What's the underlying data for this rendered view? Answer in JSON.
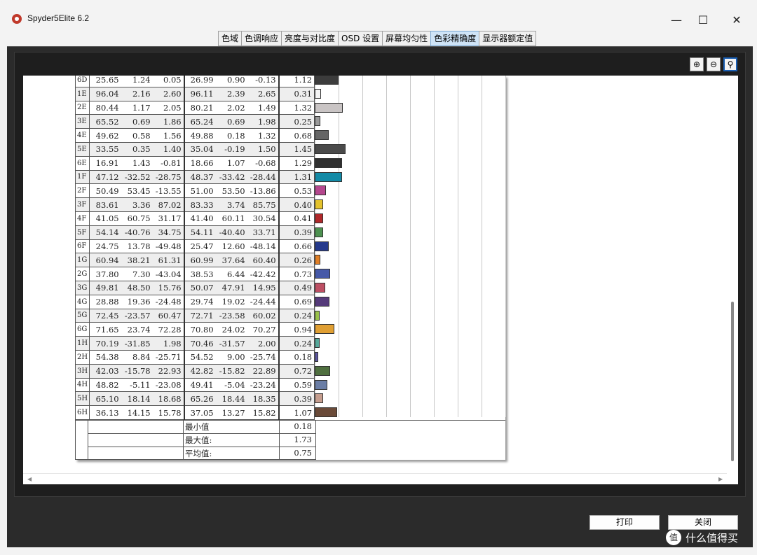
{
  "window": {
    "title": "Spyder5Elite 6.2"
  },
  "tabs": [
    "色域",
    "色调响应",
    "亮度与对比度",
    "OSD 设置",
    "屏幕均匀性",
    "色彩精确度",
    "显示器额定值"
  ],
  "active_tab_index": 5,
  "zoom": {
    "zoom_in": "zoom-in",
    "zoom_out": "zoom-out",
    "zoom_fit": "zoom-fit"
  },
  "rows": [
    [
      "6D",
      "25.65",
      "1.24",
      "0.05",
      "26.99",
      "0.90",
      "-0.13",
      "1.12"
    ],
    [
      "1E",
      "96.04",
      "2.16",
      "2.60",
      "96.11",
      "2.39",
      "2.65",
      "0.31"
    ],
    [
      "2E",
      "80.44",
      "1.17",
      "2.05",
      "80.21",
      "2.02",
      "1.49",
      "1.32"
    ],
    [
      "3E",
      "65.52",
      "0.69",
      "1.86",
      "65.24",
      "0.69",
      "1.98",
      "0.25"
    ],
    [
      "4E",
      "49.62",
      "0.58",
      "1.56",
      "49.88",
      "0.18",
      "1.32",
      "0.68"
    ],
    [
      "5E",
      "33.55",
      "0.35",
      "1.40",
      "35.04",
      "-0.19",
      "1.50",
      "1.45"
    ],
    [
      "6E",
      "16.91",
      "1.43",
      "-0.81",
      "18.66",
      "1.07",
      "-0.68",
      "1.29"
    ],
    [
      "1F",
      "47.12",
      "-32.52",
      "-28.75",
      "48.37",
      "-33.42",
      "-28.44",
      "1.31"
    ],
    [
      "2F",
      "50.49",
      "53.45",
      "-13.55",
      "51.00",
      "53.50",
      "-13.86",
      "0.53"
    ],
    [
      "3F",
      "83.61",
      "3.36",
      "87.02",
      "83.33",
      "3.74",
      "85.75",
      "0.40"
    ],
    [
      "4F",
      "41.05",
      "60.75",
      "31.17",
      "41.40",
      "60.11",
      "30.54",
      "0.41"
    ],
    [
      "5F",
      "54.14",
      "-40.76",
      "34.75",
      "54.11",
      "-40.40",
      "33.71",
      "0.39"
    ],
    [
      "6F",
      "24.75",
      "13.78",
      "-49.48",
      "25.47",
      "12.60",
      "-48.14",
      "0.66"
    ],
    [
      "1G",
      "60.94",
      "38.21",
      "61.31",
      "60.99",
      "37.64",
      "60.40",
      "0.26"
    ],
    [
      "2G",
      "37.80",
      "7.30",
      "-43.04",
      "38.53",
      "6.44",
      "-42.42",
      "0.73"
    ],
    [
      "3G",
      "49.81",
      "48.50",
      "15.76",
      "50.07",
      "47.91",
      "14.95",
      "0.49"
    ],
    [
      "4G",
      "28.88",
      "19.36",
      "-24.48",
      "29.74",
      "19.02",
      "-24.44",
      "0.69"
    ],
    [
      "5G",
      "72.45",
      "-23.57",
      "60.47",
      "72.71",
      "-23.58",
      "60.02",
      "0.24"
    ],
    [
      "6G",
      "71.65",
      "23.74",
      "72.28",
      "70.80",
      "24.02",
      "70.27",
      "0.94"
    ],
    [
      "1H",
      "70.19",
      "-31.85",
      "1.98",
      "70.46",
      "-31.57",
      "2.00",
      "0.24"
    ],
    [
      "2H",
      "54.38",
      "8.84",
      "-25.71",
      "54.52",
      "9.00",
      "-25.74",
      "0.18"
    ],
    [
      "3H",
      "42.03",
      "-15.78",
      "22.93",
      "42.82",
      "-15.82",
      "22.89",
      "0.72"
    ],
    [
      "4H",
      "48.82",
      "-5.11",
      "-23.08",
      "49.41",
      "-5.04",
      "-23.24",
      "0.59"
    ],
    [
      "5H",
      "65.10",
      "18.14",
      "18.68",
      "65.26",
      "18.44",
      "18.35",
      "0.39"
    ],
    [
      "6H",
      "36.13",
      "14.15",
      "15.78",
      "37.05",
      "13.27",
      "15.82",
      "1.07"
    ]
  ],
  "bar_colors": [
    "#3c3c3c",
    "#f4f4f4",
    "#c9c4c4",
    "#9a9a9a",
    "#666666",
    "#4a4a4a",
    "#2f2f2f",
    "#138aa6",
    "#b5478e",
    "#e4c22c",
    "#b0282a",
    "#4d9150",
    "#263a8c",
    "#e07f26",
    "#4659a8",
    "#bd4f63",
    "#553a7a",
    "#9ac24a",
    "#e09f33",
    "#56a89a",
    "#5d56a5",
    "#4f6f3f",
    "#6a7da5",
    "#c59d8e",
    "#6a4a38"
  ],
  "summary": [
    {
      "label": "最小值",
      "value": "0.18"
    },
    {
      "label": "最大值:",
      "value": "1.73"
    },
    {
      "label": "平均值:",
      "value": "0.75"
    }
  ],
  "buttons": {
    "print": "打印",
    "close": "关闭"
  },
  "watermark": "什么值得买"
}
